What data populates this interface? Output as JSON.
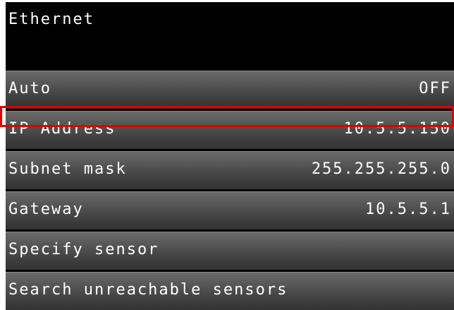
{
  "header": {
    "title": "Ethernet"
  },
  "settings": {
    "rows": [
      {
        "label": "Auto",
        "value": "OFF"
      },
      {
        "label": "IP Address",
        "value": "10.5.5.150"
      },
      {
        "label": "Subnet mask",
        "value": "255.255.255.0"
      },
      {
        "label": "Gateway",
        "value": "10.5.5.1"
      },
      {
        "label": "Specify sensor",
        "value": ""
      },
      {
        "label": "Search unreachable sensors",
        "value": ""
      }
    ],
    "highlighted_row": "IP Address"
  },
  "colors": {
    "background": "#000000",
    "row_gradient_top": "#6a6a6a",
    "row_gradient_bottom": "#333333",
    "text": "#ffffff",
    "highlight_border": "#e00000"
  }
}
